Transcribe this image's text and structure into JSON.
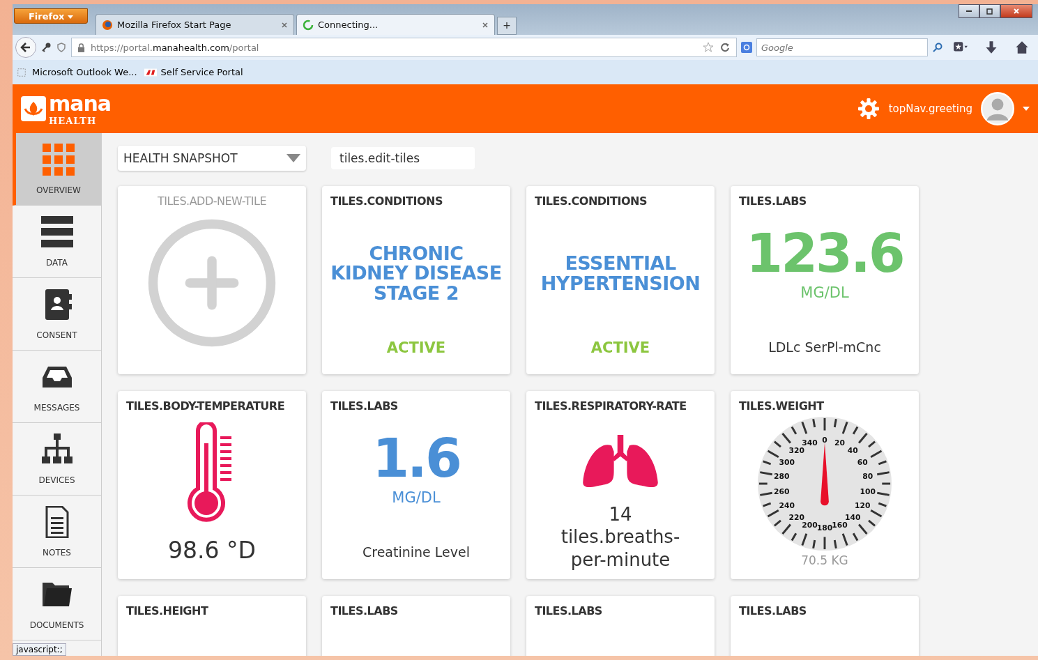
{
  "browser": {
    "menu_button": "Firefox",
    "tabs": [
      {
        "title": "Mozilla Firefox Start Page",
        "selected": false,
        "loading": false
      },
      {
        "title": "Connecting...",
        "selected": true,
        "loading": true
      }
    ],
    "new_tab": "+",
    "address": {
      "prefix": "https://portal.",
      "domain": "manahealth.com",
      "path": "/portal"
    },
    "search": {
      "placeholder": "Google"
    },
    "bookmarks": [
      "Microsoft Outlook We...",
      "Self Service Portal"
    ],
    "status_text": "javascript:;"
  },
  "header": {
    "logo_word": "mana",
    "logo_sub": "HEALTH",
    "greeting": "topNav.greeting"
  },
  "sidebar": {
    "items": [
      {
        "label": "OVERVIEW",
        "selected": true
      },
      {
        "label": "DATA",
        "selected": false
      },
      {
        "label": "CONSENT",
        "selected": false
      },
      {
        "label": "MESSAGES",
        "selected": false
      },
      {
        "label": "DEVICES",
        "selected": false
      },
      {
        "label": "NOTES",
        "selected": false
      },
      {
        "label": "DOCUMENTS",
        "selected": false
      }
    ]
  },
  "toolbar": {
    "dashboard": "HEALTH SNAPSHOT",
    "edit_tiles": "tiles.edit-tiles"
  },
  "tiles": [
    {
      "kind": "add",
      "title": "TILES.ADD-NEW-TILE"
    },
    {
      "kind": "condition",
      "title": "TILES.CONDITIONS",
      "name": "CHRONIC KIDNEY DISEASE STAGE 2",
      "status": "ACTIVE"
    },
    {
      "kind": "condition",
      "title": "TILES.CONDITIONS",
      "name": "ESSENTIAL HYPERTENSION",
      "status": "ACTIVE"
    },
    {
      "kind": "lab",
      "title": "TILES.LABS",
      "value": "123.6",
      "unit": "MG/DL",
      "name": "LDLc SerPl-mCnc",
      "color": "#6cc36c"
    },
    {
      "kind": "temperature",
      "title": "TILES.BODY-TEMPERATURE",
      "value": "98.6 °D"
    },
    {
      "kind": "lab",
      "title": "TILES.LABS",
      "value": "1.6",
      "unit": "MG/DL",
      "name": "Creatinine Level",
      "color": "#4a8fd6"
    },
    {
      "kind": "respiratory",
      "title": "TILES.RESPIRATORY-RATE",
      "value": "14",
      "unit": "tiles.breaths-per-minute"
    },
    {
      "kind": "weight",
      "title": "TILES.WEIGHT",
      "value": "70.5 KG",
      "dial": [
        "0",
        "20",
        "40",
        "60",
        "80",
        "100",
        "120",
        "140",
        "160",
        "180",
        "200",
        "220",
        "240",
        "260",
        "280",
        "300",
        "320",
        "340"
      ]
    },
    {
      "kind": "partial",
      "title": "TILES.HEIGHT"
    },
    {
      "kind": "partial",
      "title": "TILES.LABS"
    },
    {
      "kind": "partial",
      "title": "TILES.LABS"
    },
    {
      "kind": "partial",
      "title": "TILES.LABS"
    }
  ]
}
